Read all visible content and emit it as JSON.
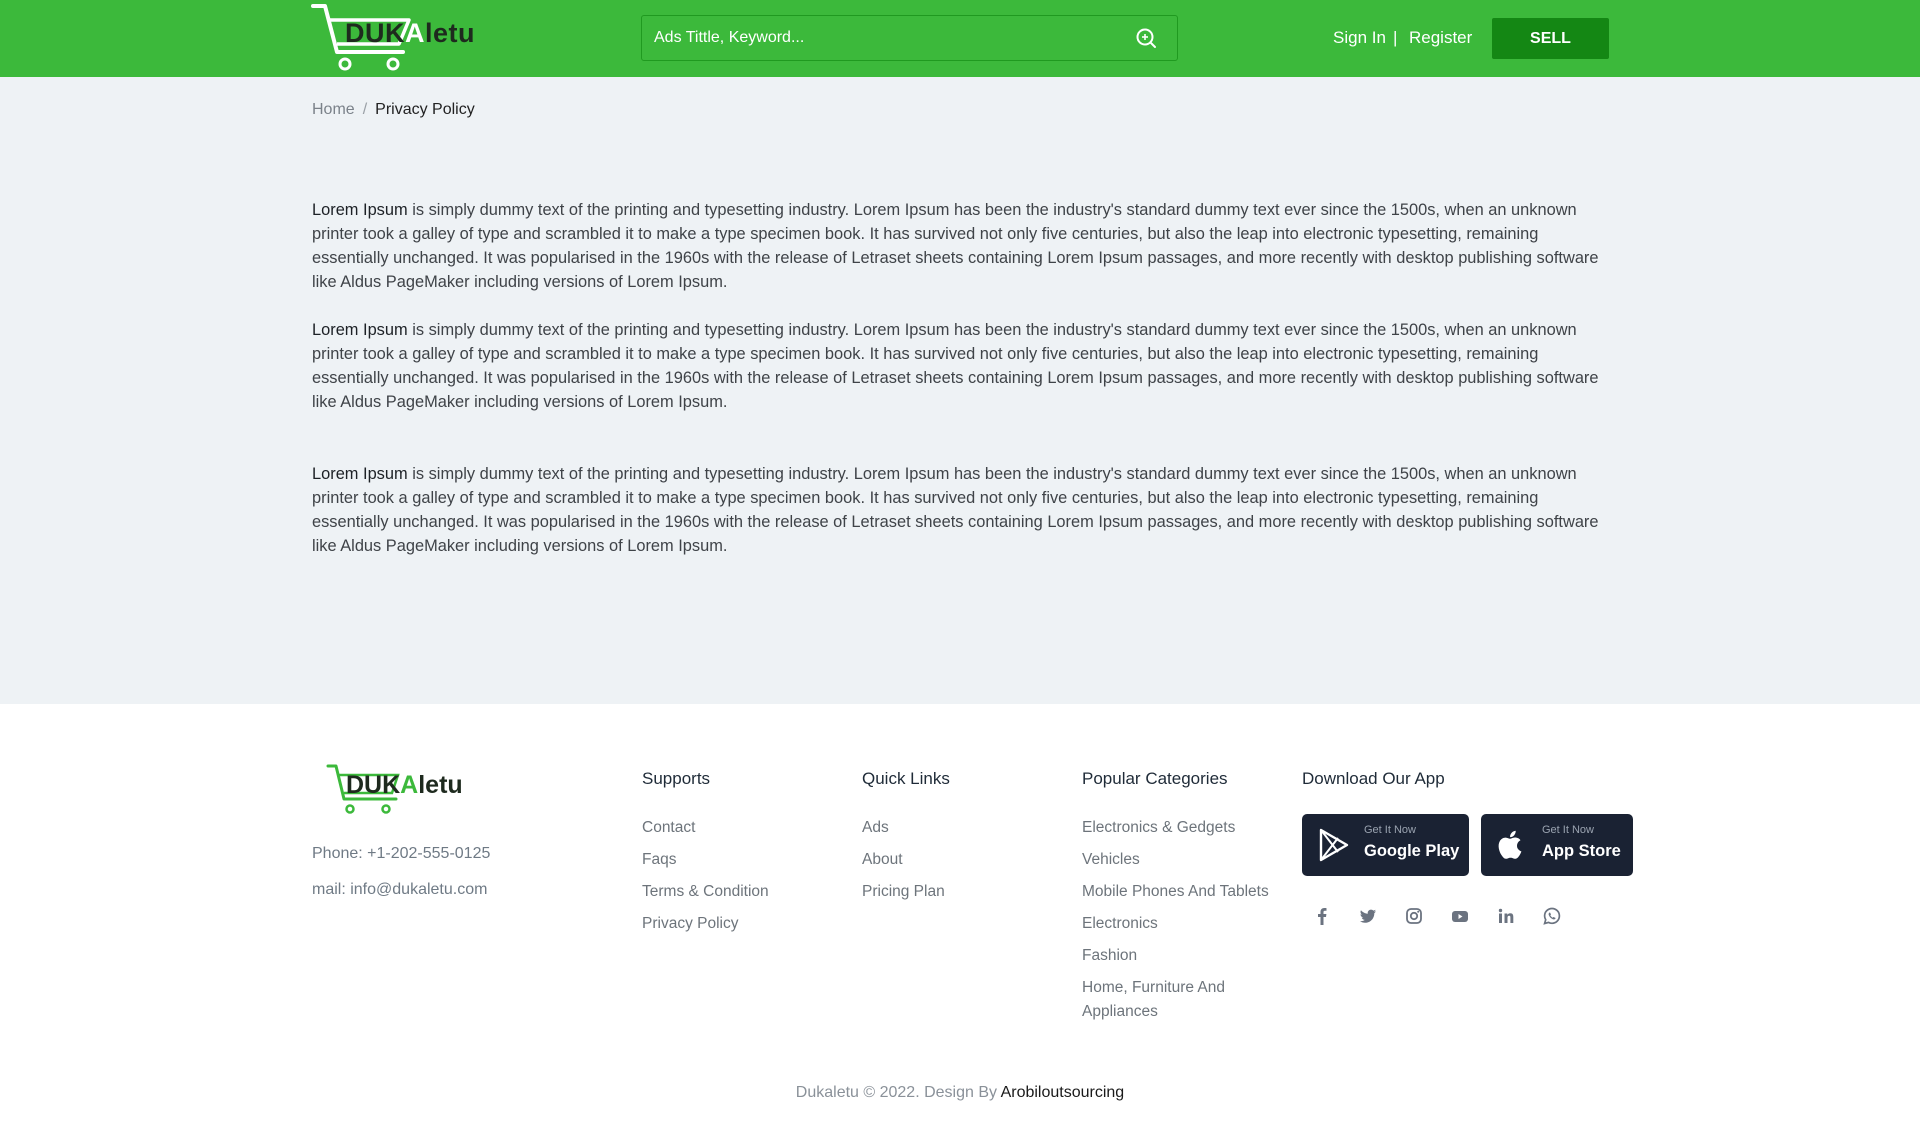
{
  "header": {
    "logo_text_1": "DUK",
    "logo_text_2": "A",
    "logo_text_3": "letu",
    "search_placeholder": "Ads Tittle, Keyword...",
    "sign_in": "Sign In",
    "separator": "|",
    "register": "Register",
    "sell": "SELL"
  },
  "breadcrumb": {
    "home": "Home",
    "separator": "/",
    "current": "Privacy Policy"
  },
  "content": {
    "paragraphs": [
      {
        "lead": "Lorem Ipsum",
        "text": " is simply dummy text of the printing and typesetting industry. Lorem Ipsum has been the industry's standard dummy text ever since the 1500s, when an unknown printer took a galley of type and scrambled it to make a type specimen book. It has survived not only five centuries, but also the leap into electronic typesetting, remaining essentially unchanged. It was popularised in the 1960s with the release of Letraset sheets containing Lorem Ipsum passages, and more recently with desktop publishing software like Aldus PageMaker including versions of Lorem Ipsum."
      },
      {
        "lead": "Lorem Ipsum",
        "text": " is simply dummy text of the printing and typesetting industry. Lorem Ipsum has been the industry's standard dummy text ever since the 1500s, when an unknown printer took a galley of type and scrambled it to make a type specimen book. It has survived not only five centuries, but also the leap into electronic typesetting, remaining essentially unchanged. It was popularised in the 1960s with the release of Letraset sheets containing Lorem Ipsum passages, and more recently with desktop publishing software like Aldus PageMaker including versions of Lorem Ipsum."
      },
      {
        "lead": "Lorem Ipsum",
        "text": " is simply dummy text of the printing and typesetting industry. Lorem Ipsum has been the industry's standard dummy text ever since the 1500s, when an unknown printer took a galley of type and scrambled it to make a type specimen book. It has survived not only five centuries, but also the leap into electronic typesetting, remaining essentially unchanged. It was popularised in the 1960s with the release of Letraset sheets containing Lorem Ipsum passages, and more recently with desktop publishing software like Aldus PageMaker including versions of Lorem Ipsum."
      }
    ]
  },
  "footer": {
    "logo_text_1": "DUK",
    "logo_text_2": "A",
    "logo_text_3": "letu",
    "phone": "Phone: +1-202-555-0125",
    "mail": "mail: info@dukaletu.com",
    "supports": {
      "title": "Supports",
      "items": [
        "Contact",
        "Faqs",
        "Terms & Condition",
        "Privacy Policy"
      ]
    },
    "quick_links": {
      "title": "Quick Links",
      "items": [
        "Ads",
        "About",
        "Pricing Plan"
      ]
    },
    "popular_categories": {
      "title": "Popular Categories",
      "items": [
        "Electronics & Gedgets",
        "Vehicles",
        "Mobile Phones And Tablets",
        "Electronics",
        "Fashion",
        "Home, Furniture And Appliances"
      ]
    },
    "download": {
      "title": "Download Our App",
      "google_small": "Get It Now",
      "google_big": "Google Play",
      "apple_small": "Get It Now",
      "apple_big": "App Store"
    },
    "social_icons": [
      "facebook-icon",
      "twitter-icon",
      "instagram-icon",
      "youtube-icon",
      "linkedin-icon",
      "whatsapp-icon"
    ],
    "copyright": "Dukaletu © 2022. Design By ",
    "designer": "Arobiloutsourcing"
  },
  "colors": {
    "brand_green": "#3cb93b",
    "sell_green": "#148714",
    "page_bg": "#eef2f5",
    "app_button": "#1a2233"
  }
}
